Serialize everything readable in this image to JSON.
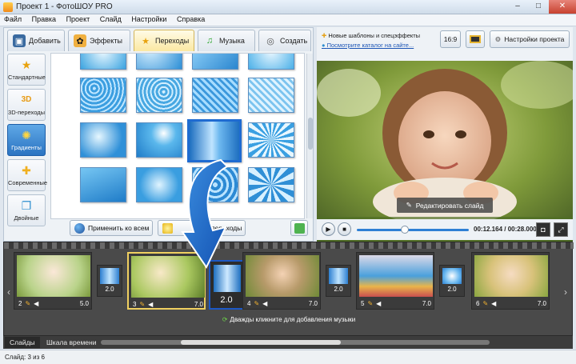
{
  "window": {
    "title": "Проект 1 - ФотоШОУ PRO",
    "minimize": "–",
    "maximize": "□",
    "close": "✕"
  },
  "menu": [
    "Файл",
    "Правка",
    "Проект",
    "Слайд",
    "Настройки",
    "Справка"
  ],
  "tabs": [
    {
      "label": "Добавить",
      "icon": "camera-icon"
    },
    {
      "label": "Эффекты",
      "icon": "palette-icon"
    },
    {
      "label": "Переходы",
      "icon": "star-icon",
      "active": true
    },
    {
      "label": "Музыка",
      "icon": "music-note-icon"
    },
    {
      "label": "Создать",
      "icon": "disc-icon"
    }
  ],
  "categories": [
    {
      "label": "Стандартные",
      "icon": "star-icon"
    },
    {
      "label": "3D-переходы",
      "icon": "3d-icon"
    },
    {
      "label": "Градиенты",
      "icon": "sun-icon",
      "active": true
    },
    {
      "label": "Современные",
      "icon": "puzzle-icon"
    },
    {
      "label": "Двойные",
      "icon": "double-icon"
    }
  ],
  "buttons": {
    "apply_all": "Применить ко всем",
    "random": "переходы"
  },
  "news": {
    "line1": "Новые шаблоны и спецэффекты",
    "line2": "Посмотрите каталог на сайте..."
  },
  "right_toolbar": {
    "ratio": "16:9",
    "settings": "Настройки проекта"
  },
  "preview": {
    "edit_slide": "Редактировать слайд"
  },
  "player": {
    "time": "00:12.164 / 00:28.000",
    "progress": 0.43
  },
  "slides": [
    {
      "num": "2",
      "dur": "5.0",
      "palette": "light-child"
    },
    {
      "num": "3",
      "dur": "7.0",
      "palette": "garden",
      "current": true
    },
    {
      "num": "4",
      "dur": "7.0",
      "palette": "girl-grass"
    },
    {
      "num": "5",
      "dur": "7.0",
      "palette": "sleeping"
    },
    {
      "num": "6",
      "dur": "7.0",
      "palette": "boy"
    }
  ],
  "transitions": [
    {
      "dur": "2.0"
    },
    {
      "dur": "2.0"
    },
    {
      "dur": "2.0"
    }
  ],
  "big_transition": {
    "dur": "2.0"
  },
  "music_hint": "Дважды кликните для добавления музыки",
  "bottom_tabs": {
    "slides": "Слайды",
    "timeline": "Шкала времени"
  },
  "status": "Слайд: 3 из 6"
}
